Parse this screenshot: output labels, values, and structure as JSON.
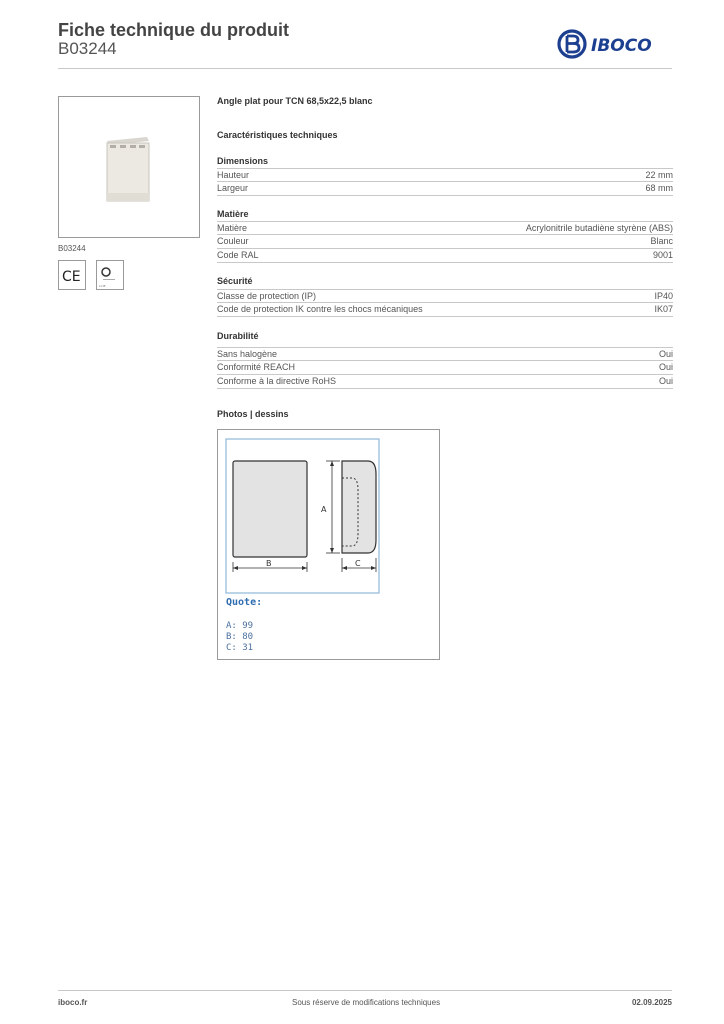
{
  "header": {
    "title": "Fiche technique du produit",
    "code": "B03244",
    "brand": "IBOCO"
  },
  "product": {
    "image_caption": "B03244",
    "name": "Angle plat pour TCN 68,5x22,5 blanc",
    "certifications": [
      "CE",
      "LCIE"
    ]
  },
  "spec_title": "Caractéristiques techniques",
  "sections": [
    {
      "title": "Dimensions",
      "rows": [
        {
          "label": "Hauteur",
          "value": "22 mm"
        },
        {
          "label": "Largeur",
          "value": "68 mm"
        }
      ]
    },
    {
      "title": "Matière",
      "rows": [
        {
          "label": "Matière",
          "value": "Acrylonitrile butadiène styrène (ABS)"
        },
        {
          "label": "Couleur",
          "value": "Blanc"
        },
        {
          "label": "Code RAL",
          "value": "9001"
        }
      ]
    },
    {
      "title": "Sécurité",
      "rows": [
        {
          "label": "Classe de protection (IP)",
          "value": "IP40"
        },
        {
          "label": "Code de protection IK contre les chocs mécaniques",
          "value": "IK07"
        }
      ]
    },
    {
      "title": "Durabilité",
      "rows": [
        {
          "label": "Sans halogène",
          "value": "Oui"
        },
        {
          "label": "Conformité REACH",
          "value": "Oui"
        },
        {
          "label": "Conforme à la directive RoHS",
          "value": "Oui"
        }
      ]
    }
  ],
  "drawing": {
    "title": "Photos | dessins",
    "dim_labels": {
      "a": "A",
      "b": "B",
      "c": "C"
    },
    "quote_title": "Quote:",
    "quotes": [
      "A: 99",
      "B: 80",
      "C: 31"
    ]
  },
  "footer": {
    "left": "iboco.fr",
    "center": "Sous réserve de modifications techniques",
    "right": "02.09.2025"
  },
  "colors": {
    "brand_blue": "#1c3f8f",
    "drawing_frame": "#8fb7d9",
    "drawing_fill": "#e3e3e3"
  }
}
